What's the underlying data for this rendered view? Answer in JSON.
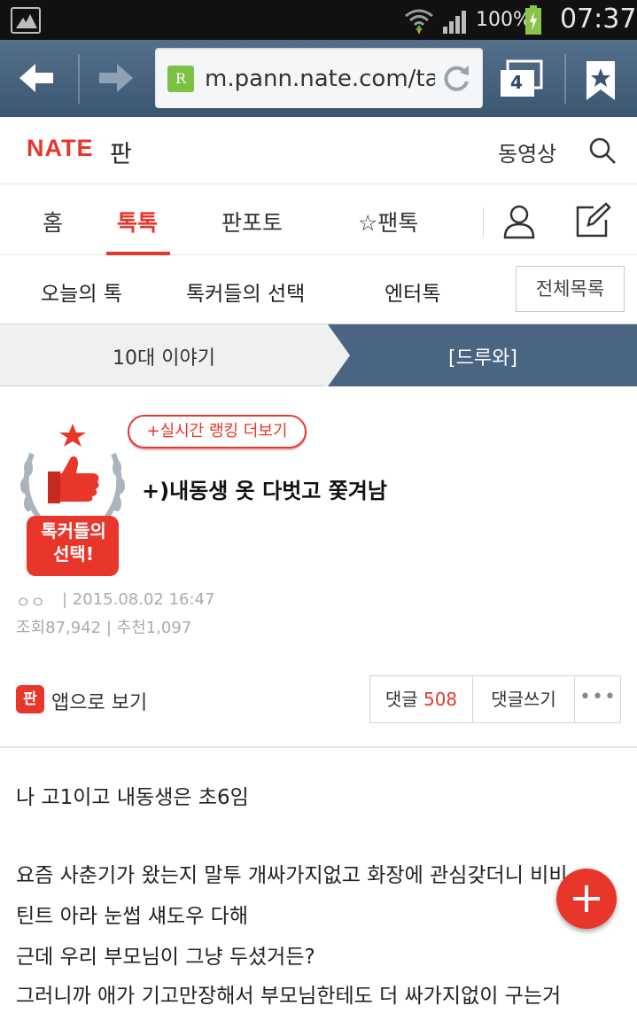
{
  "status_bar": {
    "battery": "100%",
    "time": "07:37"
  },
  "browser": {
    "url": "m.pann.nate.com/tal",
    "tab_count": "4",
    "favicon_letter": "R"
  },
  "site": {
    "logo": "NATE",
    "logo_sub": "판",
    "video_link": "동영상"
  },
  "main_nav": {
    "items": [
      {
        "label": "홈"
      },
      {
        "label": "톡톡"
      },
      {
        "label": "판포토"
      },
      {
        "label": "☆팬톡"
      }
    ]
  },
  "sub_nav": {
    "items": [
      {
        "label": "오늘의 톡"
      },
      {
        "label": "톡커들의 선택"
      },
      {
        "label": "엔터톡"
      }
    ],
    "all_list": "전체목록"
  },
  "category": {
    "left": "10대 이야기",
    "right": "[드루와]"
  },
  "article": {
    "badge_line1": "톡커들의",
    "badge_line2": "선택!",
    "ranking_button": "+실시간 랭킹 더보기",
    "title": "+)내동생 옷 다벗고 쫓겨남",
    "author": "ㅇㅇ",
    "date": "| 2015.08.02 16:47",
    "stats": "조회87,942 | 추천1,097"
  },
  "actions": {
    "app_icon": "판",
    "app_view": "앱으로 보기",
    "comments_label": "댓글",
    "comments_count": "508",
    "write_comment": "댓글쓰기",
    "more": "•••"
  },
  "body": {
    "lines": [
      "나 고1이고 내동생은 초6임",
      "요즘 사춘기가 왔는지 말투 개싸가지없고 화장에 관심갖더니 비비",
      "틴트 아라 눈썹 섀도우 다해",
      "근데 우리 부모님이 그냥 두셨거든?",
      "그러니까 애가 기고만장해서 부모님한테도 더 싸가지없이 구는거"
    ]
  },
  "colors": {
    "brand_red": "#e8362b",
    "browser_bar": "#4a6582"
  }
}
